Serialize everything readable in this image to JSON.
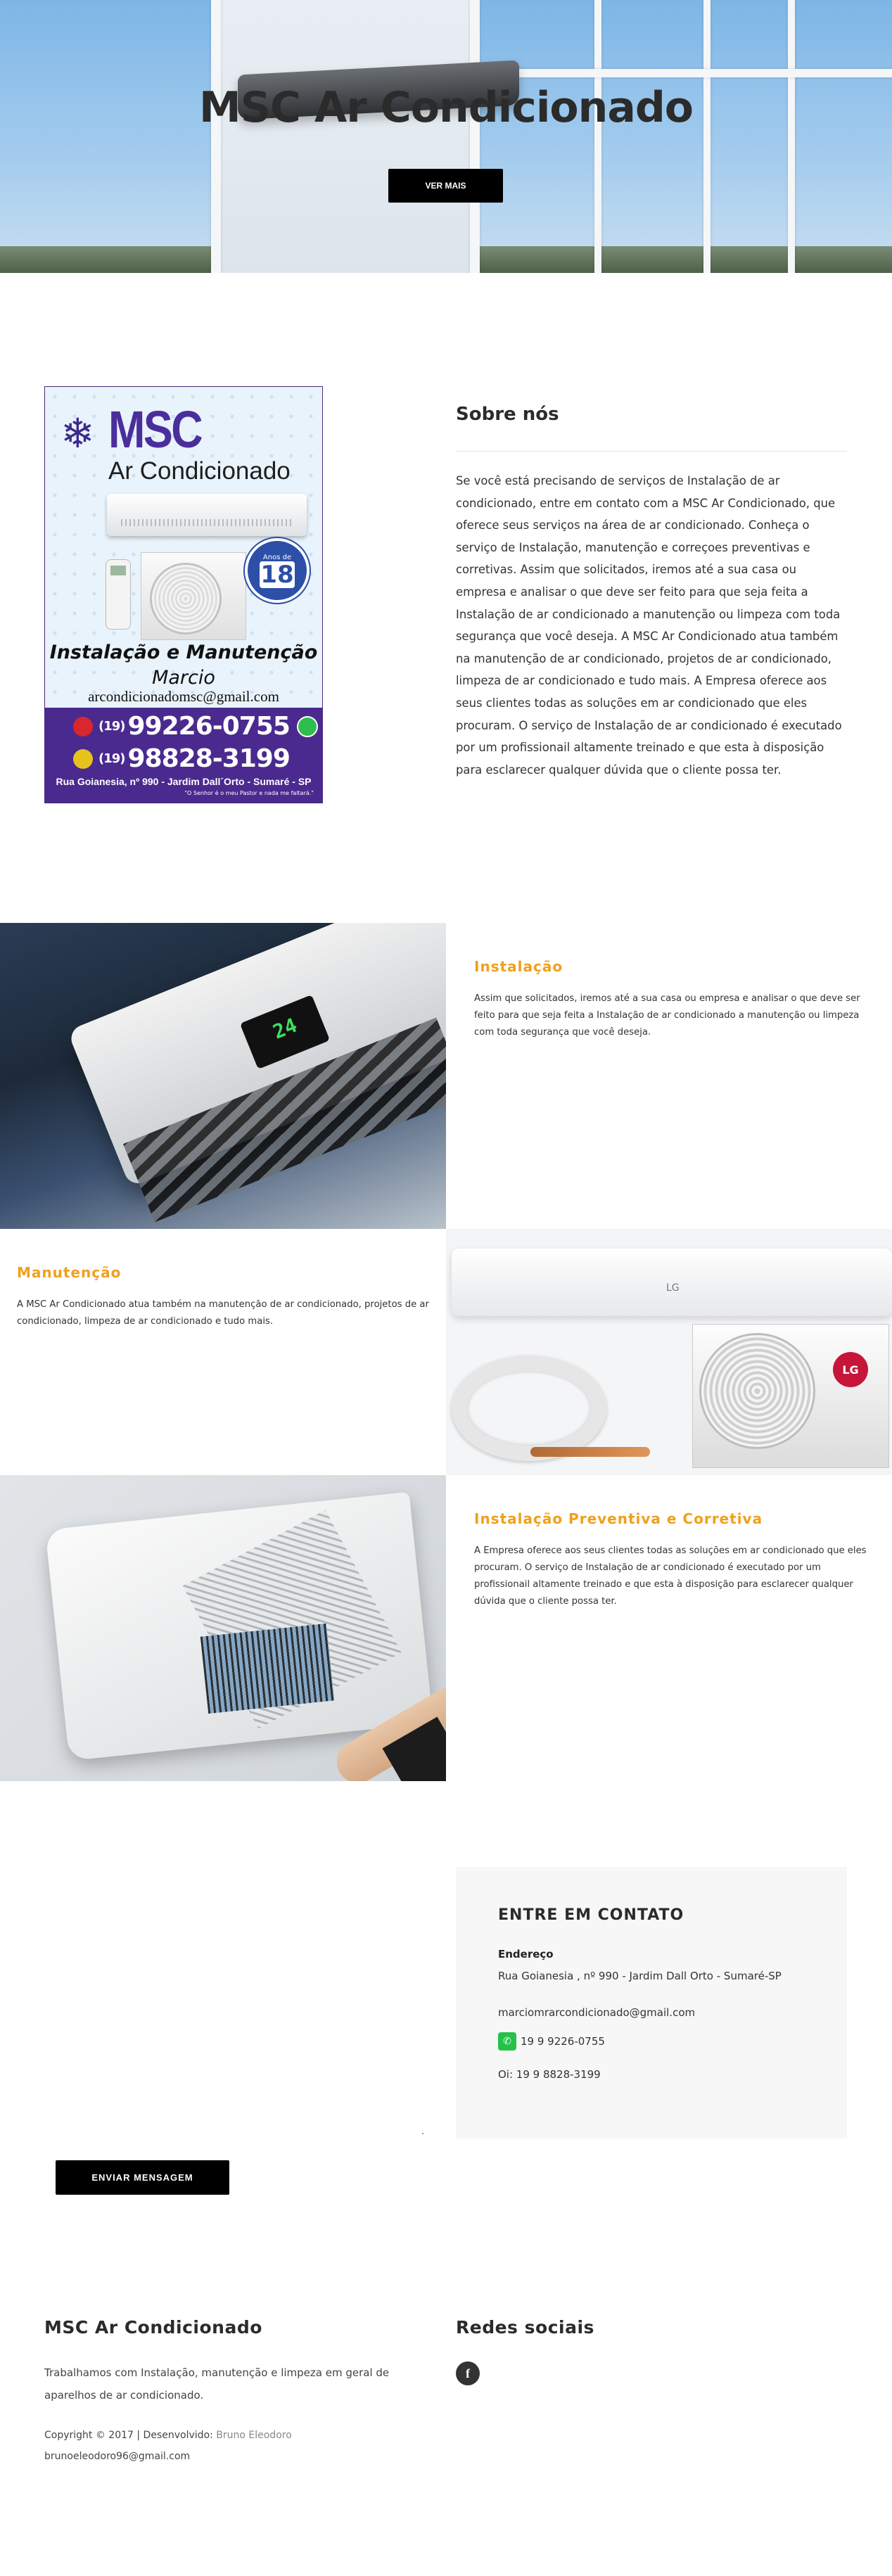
{
  "hero": {
    "title": "MSC Ar Condicionado",
    "button_label": "VER MAIS"
  },
  "flyer": {
    "brand": "MSC",
    "brand_sub": "Ar Condicionado",
    "badge_number": "18",
    "badge_text": "Anos de",
    "service": "Instalação e Manutenção",
    "person": "Marcio",
    "email": "arcondicionadomsc@gmail.com",
    "area_code_1": "(19)",
    "phone_1": "99226-0755",
    "area_code_2": "(19)",
    "phone_2": "98828-3199",
    "address": "Rua Goianesia, nº 990 - Jardim Dall´Orto - Sumaré - SP",
    "slogan": "\"O Senhor é o meu Pastor e nada me faltará.\""
  },
  "about": {
    "heading": "Sobre nós",
    "body": "Se você está precisando de serviços de Instalação de ar condicionado, entre em contato com a MSC Ar Condicionado, que oferece seus serviços na área de ar condicionado. Conheça o serviço de Instalação, manutenção e correçoes preventivas e corretivas. Assim que solicitados, iremos até a sua casa ou empresa e analisar o que deve ser feito para que seja feita a Instalação de ar condicionado a manutenção ou limpeza com toda segurança que você deseja. A MSC Ar Condicionado atua também na manutenção de ar condicionado, projetos de ar condicionado, limpeza de ar condicionado e tudo mais. A Empresa oferece aos seus clientes todas as soluções em ar condicionado que eles procuram. O serviço de Instalação de ar condicionado é executado por um profissionail altamente treinado e que esta à disposição para esclarecer qualquer dúvida que o cliente possa ter."
  },
  "services": [
    {
      "title": "Instalação",
      "text": "Assim que solicitados, iremos até a sua casa ou empresa e analisar o que deve ser feito para que seja feita a Instalação de ar condicionado a manutenção ou limpeza com toda segurança que você deseja."
    },
    {
      "title": "Manutenção",
      "text": "A MSC Ar Condicionado atua também na manutenção de ar condicionado, projetos de ar condicionado, limpeza de ar condicionado e tudo mais."
    },
    {
      "title": "Instalação Preventiva e Corretiva",
      "text": "A Empresa oferece aos seus clientes todas as soluções em ar condicionado que eles procuram. O serviço de Instalação de ar condicionado é executado por um profissionail altamente treinado e que esta à disposição para esclarecer qualquer dúvida que o cliente possa ter."
    }
  ],
  "contact": {
    "heading": "ENTRE EM CONTATO",
    "address_label": "Endereço",
    "address": "Rua Goianesia , nº 990 - Jardim Dall Orto - Sumaré-SP",
    "email": "marciomrarcondicionado@gmail.com",
    "whatsapp": "19 9 9226-0755",
    "oi": "Oi: 19 9 8828-3199",
    "send_button": "ENVIAR MENSAGEM"
  },
  "footer": {
    "brand_heading": "MSC Ar Condicionado",
    "brand_text": "Trabalhamos com Instalação, manutenção e limpeza em geral de aparelhos de ar condicionado.",
    "copyright": "Copyright © 2017 | Desenvolvido: ",
    "developer": "Bruno Eleodoro",
    "developer_email": "brunoeleodoro96@gmail.com",
    "social_heading": "Redes sociais",
    "facebook_glyph": "f"
  },
  "colors": {
    "accent": "#f0a01c",
    "button": "#000000",
    "panel": "#f7f7f7"
  },
  "icons": [
    "snowflake-icon",
    "whatsapp-icon",
    "facebook-icon"
  ]
}
